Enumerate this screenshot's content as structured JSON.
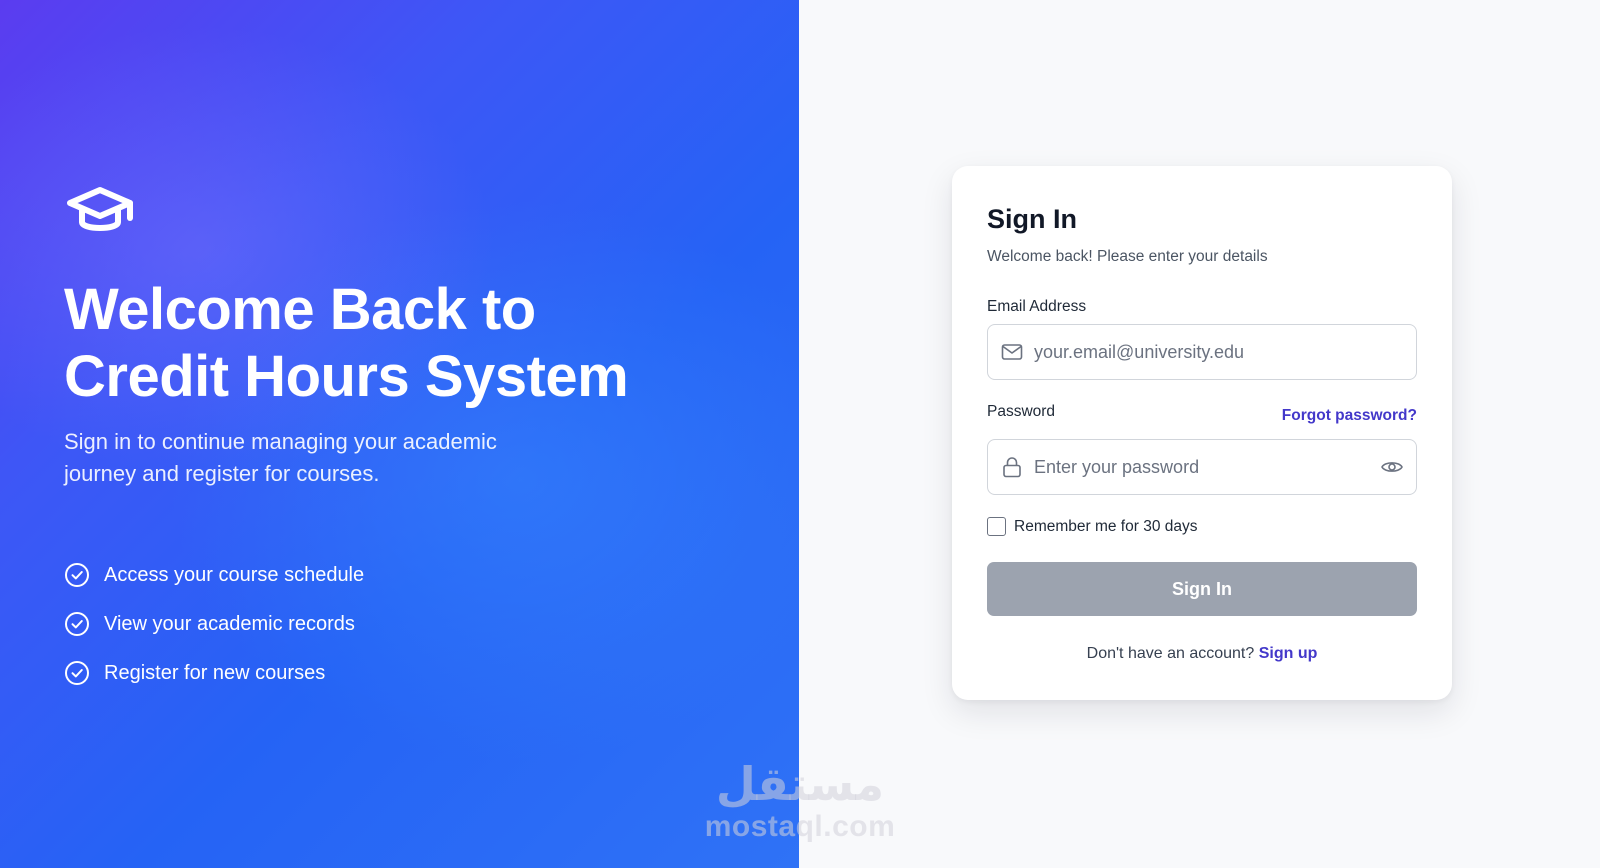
{
  "hero": {
    "icon": "graduation-cap-icon",
    "title": "Welcome Back to\nCredit Hours System",
    "subtitle": "Sign in to continue managing your academic journey and register for courses.",
    "features": [
      {
        "icon": "check-circle-icon",
        "label": "Access your course schedule"
      },
      {
        "icon": "check-circle-icon",
        "label": "View your academic records"
      },
      {
        "icon": "check-circle-icon",
        "label": "Register for new courses"
      }
    ]
  },
  "form": {
    "title": "Sign In",
    "subtitle": "Welcome back! Please enter your details",
    "email_label": "Email Address",
    "email_placeholder": "your.email@university.edu",
    "email_value": "",
    "password_label": "Password",
    "password_placeholder": "Enter your password",
    "password_value": "",
    "forgot_label": "Forgot password?",
    "remember_label": "Remember me for 30 days",
    "remember_checked": false,
    "submit_label": "Sign In",
    "signup_prompt": "Don't have an account?",
    "signup_link": "Sign up"
  },
  "watermark": {
    "arabic": "مستقل",
    "latin": "mostaql.com"
  },
  "colors": {
    "gradient_start": "#5b3cf0",
    "gradient_end": "#2f72f6",
    "link": "#4338ca",
    "button_disabled": "#9ca3af",
    "heading": "#111827"
  }
}
